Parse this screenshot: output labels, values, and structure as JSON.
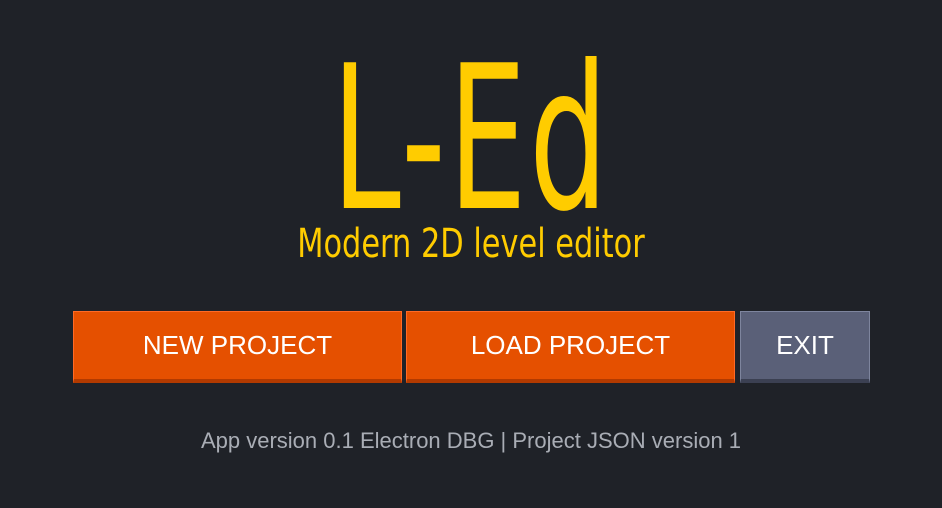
{
  "app": {
    "logo": "L-Ed",
    "tagline": "Modern 2D level editor"
  },
  "menu": {
    "new_project": "NEW PROJECT",
    "load_project": "LOAD PROJECT",
    "exit": "EXIT"
  },
  "footer": {
    "version_info": "App version 0.1 Electron DBG | Project JSON version 1"
  },
  "colors": {
    "background": "#1f2228",
    "accent": "#ffcc00",
    "primary_button": "#e55000",
    "secondary_button": "#5a6078",
    "footer_text": "#a9adb5"
  }
}
